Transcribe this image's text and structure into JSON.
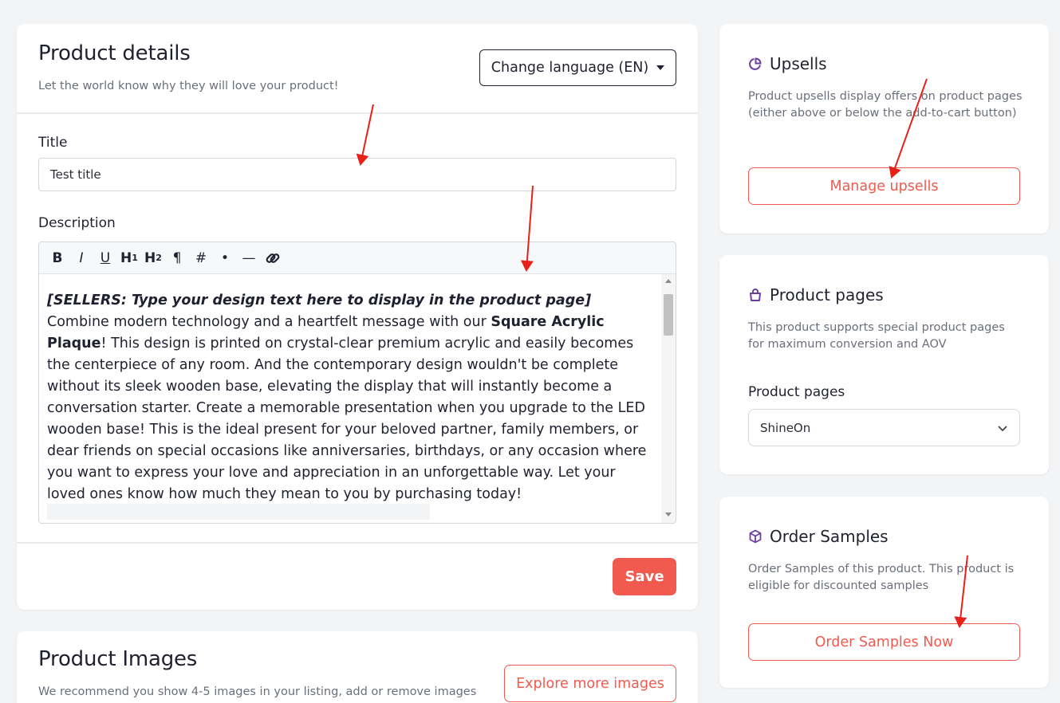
{
  "product_details": {
    "title": "Product details",
    "subtitle": "Let the world know why they will love your product!",
    "change_language_label": "Change language (EN)",
    "title_field": {
      "label": "Title",
      "value": "Test title"
    },
    "description_field": {
      "label": "Description",
      "toolbar": [
        "B",
        "I",
        "U",
        "H1",
        "H2",
        "¶",
        "#",
        "•",
        "—",
        "link"
      ],
      "seller_note": "[SELLERS: Type your design text here to display in the product page]",
      "text_before_bold": "Combine modern technology and a heartfelt message with our ",
      "bold_text": "Square Acrylic Plaque",
      "text_after_bold": "! This design is printed on crystal-clear premium acrylic and easily becomes the centerpiece of any room. And the contemporary design wouldn't be complete without its sleek wooden base, elevating the display that will instantly become a conversation starter. Create a memorable presentation when you upgrade to the LED wooden base! This is the ideal present for your beloved partner, family members, or dear friends on special occasions like anniversaries, birthdays, or any occasion where you want to express your love and appreciation in an unforgettable way. Let your loved ones know how much they mean to you by purchasing today!"
    },
    "save_label": "Save"
  },
  "product_images": {
    "title": "Product Images",
    "subtitle": "We recommend you show 4-5 images in your listing, add or remove images",
    "explore_label": "Explore more images"
  },
  "upsells": {
    "icon": "pie-chart-icon",
    "title": "Upsells",
    "description": "Product upsells display offers on product pages (either above or below the add-to-cart button)",
    "button_label": "Manage upsells"
  },
  "product_pages": {
    "icon": "shopping-bag-icon",
    "title": "Product pages",
    "description": "This product supports special product pages for maximum conversion and AOV",
    "select_label": "Product pages",
    "select_value": "ShineOn"
  },
  "order_samples": {
    "icon": "box-icon",
    "title": "Order Samples",
    "description": "Order Samples of this product. This product is eligible for discounted samples",
    "button_label": "Order Samples Now"
  },
  "colors": {
    "accent": "#f05a4f",
    "icon_purple": "#6b3fa0",
    "annotation_red": "#e8201a",
    "background": "#f3f4f6"
  }
}
